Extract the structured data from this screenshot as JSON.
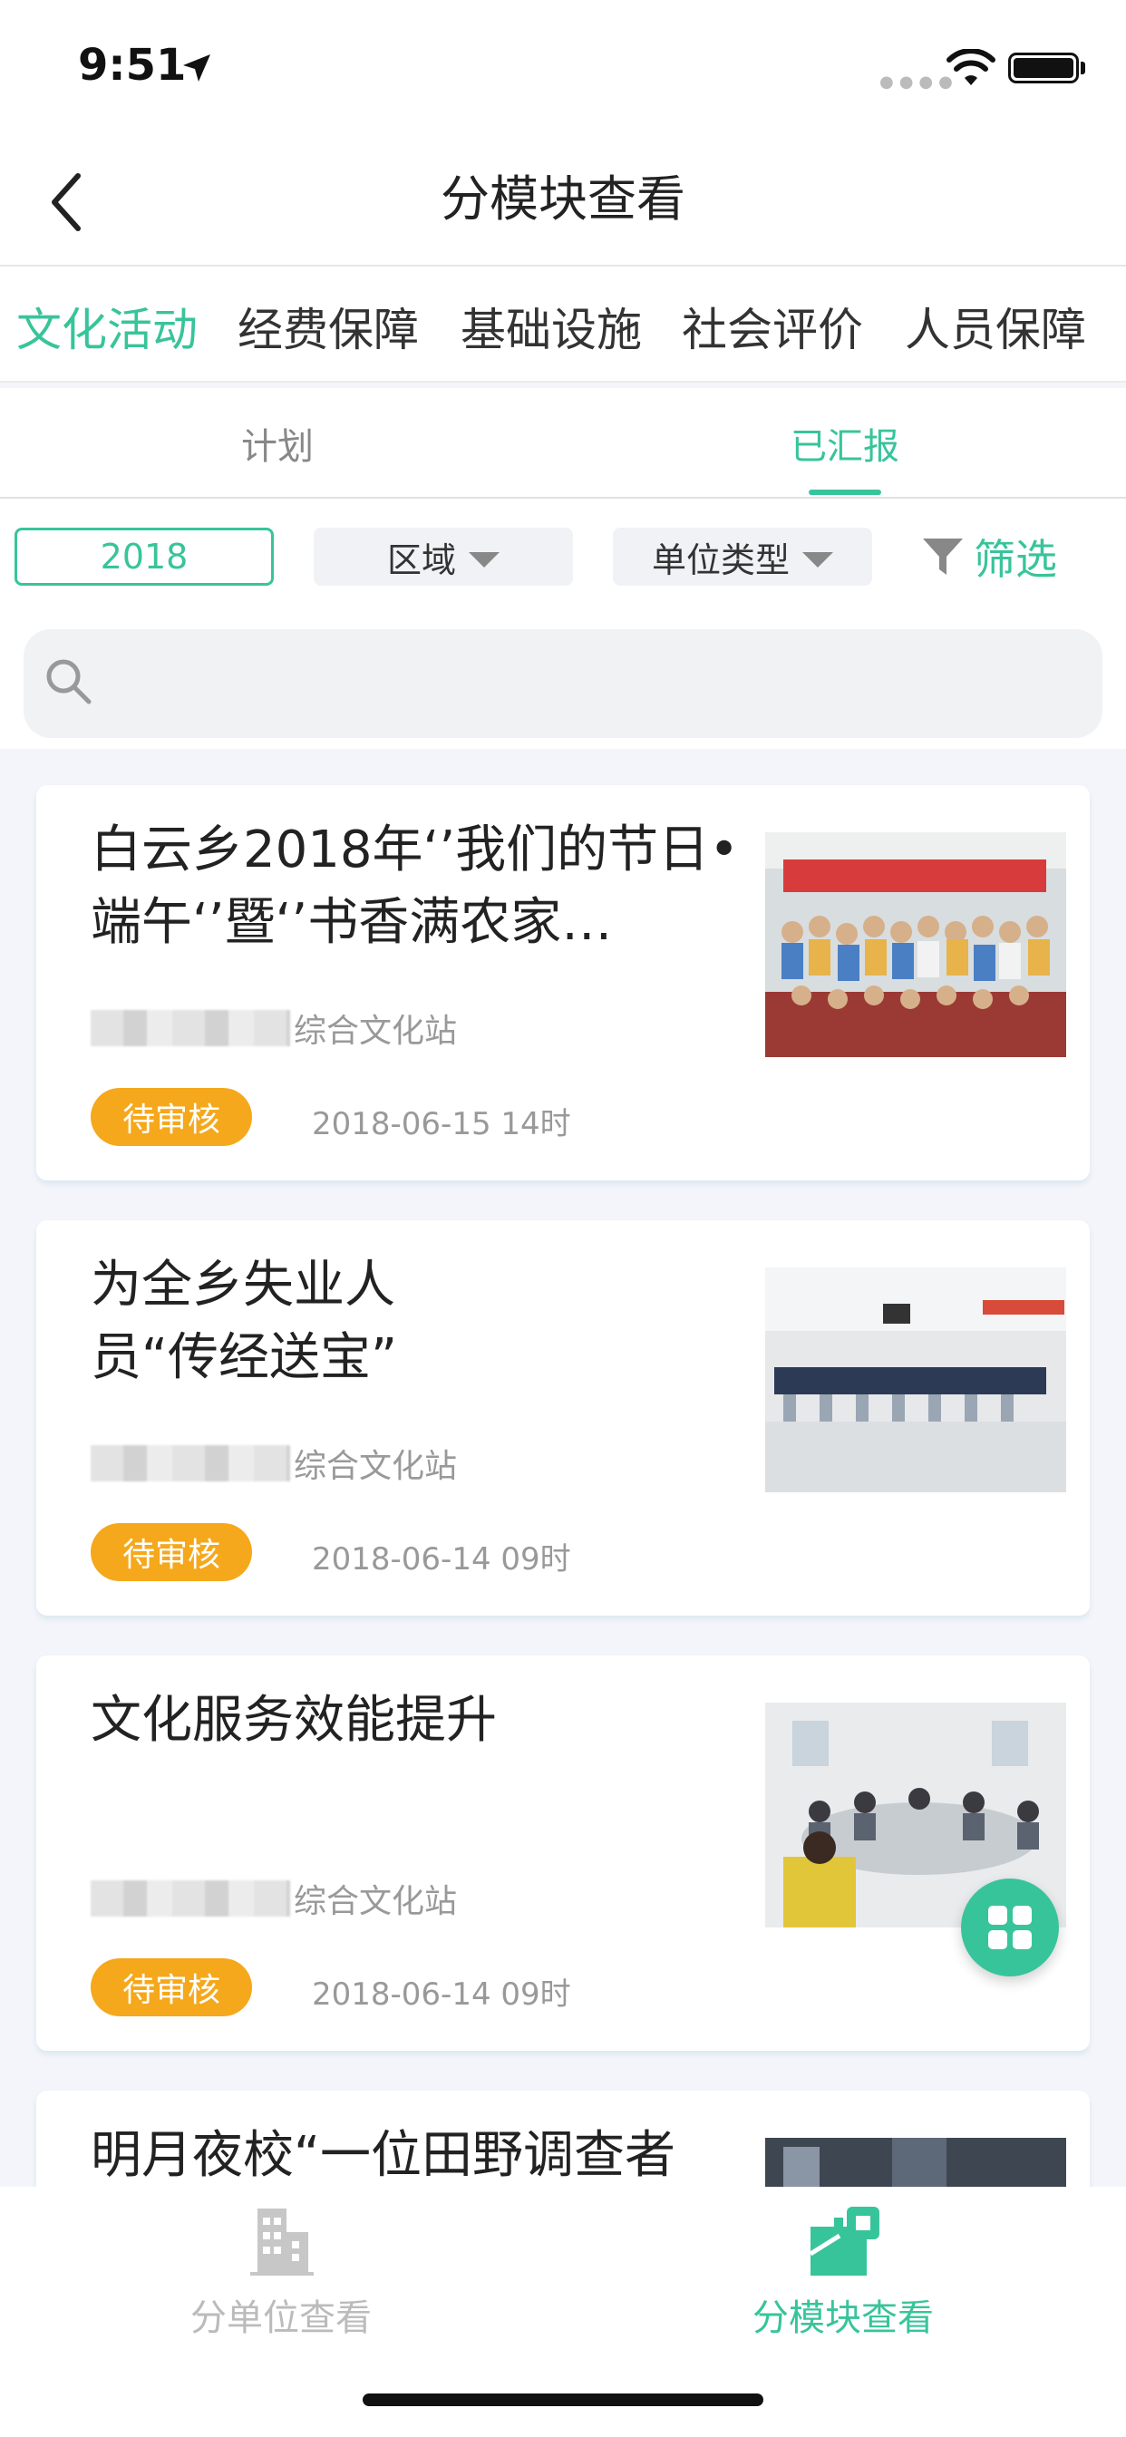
{
  "status_bar": {
    "time": "9:51"
  },
  "header": {
    "title": "分模块查看"
  },
  "module_tabs": [
    {
      "label": "文化活动",
      "active": true
    },
    {
      "label": "经费保障",
      "active": false
    },
    {
      "label": "基础设施",
      "active": false
    },
    {
      "label": "社会评价",
      "active": false
    },
    {
      "label": "人员保障",
      "active": false
    }
  ],
  "sub_tabs": [
    {
      "label": "计划",
      "active": false
    },
    {
      "label": "已汇报",
      "active": true
    }
  ],
  "filters": {
    "year": "2018",
    "region": "区域",
    "unit_type": "单位类型",
    "filter": "筛选"
  },
  "search": {
    "placeholder": ""
  },
  "cards": [
    {
      "title": "白云乡2018年‘’我们的节日•端午‘’暨‘’书香满农家…",
      "org": "综合文化站",
      "status": "待审核",
      "date": "2018-06-15 14时"
    },
    {
      "title": "为全乡失业人员“传经送宝”",
      "org": "综合文化站",
      "status": "待审核",
      "date": "2018-06-14 09时"
    },
    {
      "title": "文化服务效能提升",
      "org": "综合文化站",
      "status": "待审核",
      "date": "2018-06-14 09时"
    },
    {
      "title": "明月夜校“一位田野调查者",
      "org": "",
      "status": "",
      "date": ""
    }
  ],
  "bottom_tabs": [
    {
      "label": "分单位查看",
      "active": false
    },
    {
      "label": "分模块查看",
      "active": true
    }
  ],
  "colors": {
    "accent": "#38c49a",
    "badge": "#f5a81b",
    "inactive": "#bbbbbb"
  }
}
